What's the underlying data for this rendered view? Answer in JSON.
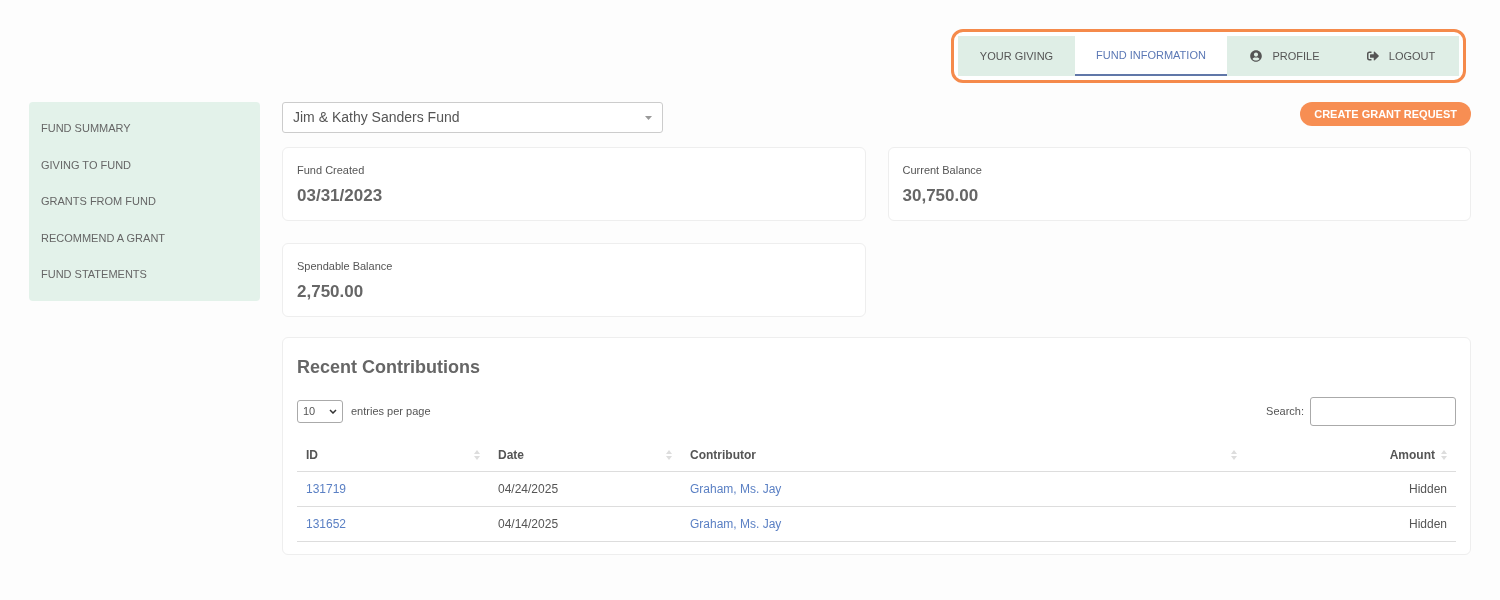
{
  "nav_tabs": [
    {
      "label": "YOUR GIVING",
      "selected": false,
      "kind": "plain"
    },
    {
      "label": "FUND INFORMATION",
      "selected": true,
      "kind": "plain"
    },
    {
      "label": "PROFILE",
      "selected": false,
      "kind": "profile"
    },
    {
      "label": "LOGOUT",
      "selected": false,
      "kind": "logout"
    }
  ],
  "sidebar": {
    "items": [
      "FUND SUMMARY",
      "GIVING TO FUND",
      "GRANTS FROM FUND",
      "RECOMMEND A GRANT",
      "FUND STATEMENTS"
    ]
  },
  "fund_select": {
    "value": "Jim & Kathy Sanders Fund"
  },
  "create_button": "CREATE GRANT REQUEST",
  "stats": [
    {
      "label": "Fund Created",
      "value": "03/31/2023"
    },
    {
      "label": "Current Balance",
      "value": "30,750.00"
    },
    {
      "label": "Spendable Balance",
      "value": "2,750.00"
    }
  ],
  "contributions": {
    "title": "Recent Contributions",
    "page_size": "10",
    "page_size_label": "entries per page",
    "search_label": "Search:",
    "columns": [
      "ID",
      "Date",
      "Contributor",
      "Amount"
    ],
    "rows": [
      [
        "131719",
        "04/24/2025",
        "Graham, Ms. Jay",
        "Hidden"
      ],
      [
        "131652",
        "04/14/2025",
        "Graham, Ms. Jay",
        "Hidden"
      ]
    ]
  }
}
